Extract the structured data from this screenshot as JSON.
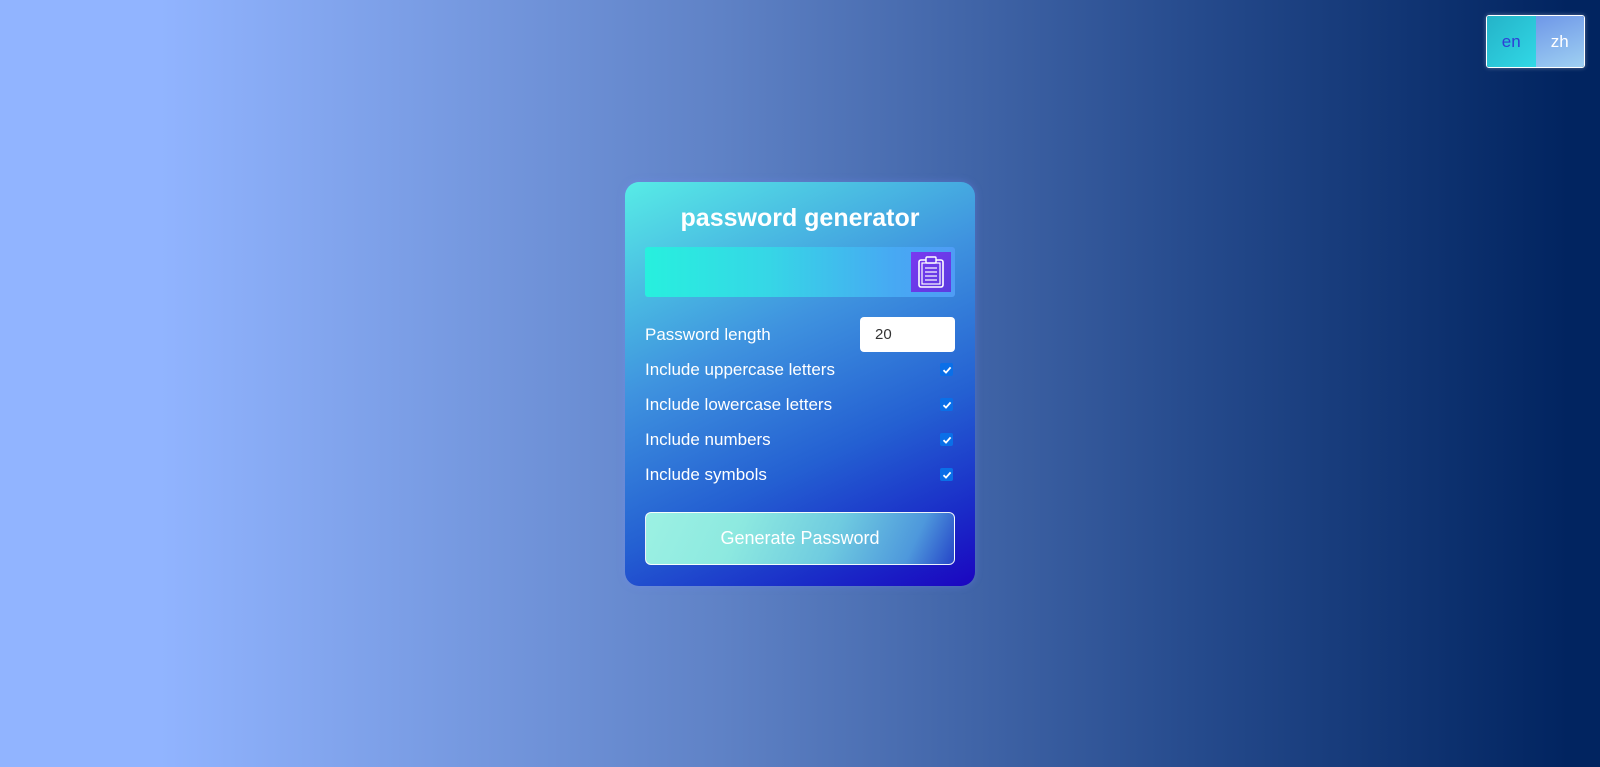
{
  "language": {
    "options": [
      "en",
      "zh"
    ],
    "active": "en"
  },
  "card": {
    "title": "password generator",
    "password_output": "",
    "copy_icon": "clipboard-icon",
    "settings": {
      "length_label": "Password length",
      "length_value": "20",
      "uppercase_label": "Include uppercase letters",
      "uppercase_checked": true,
      "lowercase_label": "Include lowercase letters",
      "lowercase_checked": true,
      "numbers_label": "Include numbers",
      "numbers_checked": true,
      "symbols_label": "Include symbols",
      "symbols_checked": true
    },
    "generate_label": "Generate Password"
  },
  "colors": {
    "accent": "#1b05c0",
    "checkbox": "#0a6fe8",
    "copy_button": "#6a3ae8"
  }
}
